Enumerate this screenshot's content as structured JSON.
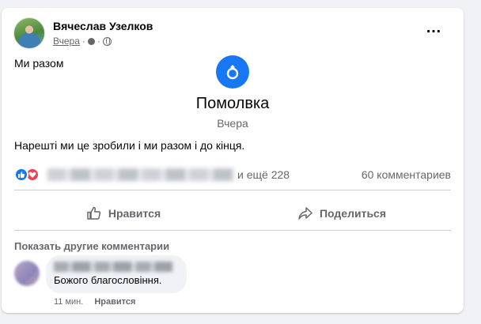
{
  "post": {
    "author": "Вячеслав Узелков",
    "time": "Вчера",
    "separator": "·",
    "text": "Ми разом",
    "more_icon": "…"
  },
  "event": {
    "icon": "ring-icon",
    "title": "Помолвка",
    "date": "Вчера",
    "caption": "Нарешті ми це зробили і ми разом і до кінця."
  },
  "reactions": {
    "names_tail": "и ещё 228",
    "comments": "60 комментариев"
  },
  "actions": {
    "like": "Нравится",
    "share": "Поделиться"
  },
  "comments": {
    "show_more": "Показать другие комментарии",
    "items": [
      {
        "text": "Божого благословіння.",
        "time": "11 мин.",
        "like": "Нравится"
      }
    ]
  },
  "colors": {
    "accent": "#1877f2",
    "love": "#f33e58",
    "muted": "#65676b",
    "background": "#f0f2f5"
  }
}
